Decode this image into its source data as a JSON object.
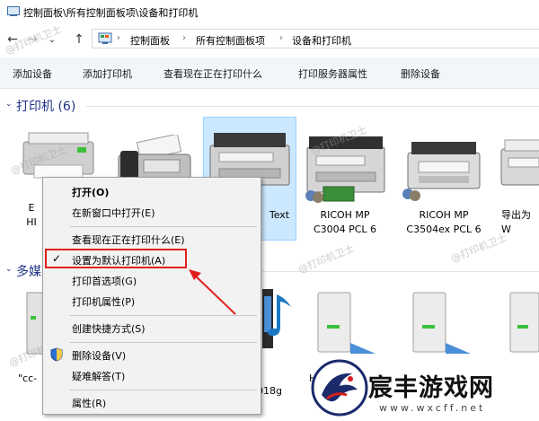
{
  "window": {
    "title": "控制面板\\所有控制面板项\\设备和打印机"
  },
  "nav": {
    "back": "←",
    "forward": "→",
    "dropdown": "⌄",
    "up": "↑"
  },
  "breadcrumb": [
    {
      "label": "控制面板"
    },
    {
      "label": "所有控制面板项"
    },
    {
      "label": "设备和打印机"
    }
  ],
  "toolbar": {
    "add_device": "添加设备",
    "add_printer": "添加打印机",
    "see_printing": "查看现在正在打印什么",
    "print_server_props": "打印服务器属性",
    "remove_device": "删除设备"
  },
  "printers_group": {
    "title": "打印机 (6)"
  },
  "printers": {
    "p1": {
      "line1": "E",
      "line2": "HI"
    },
    "p3": {
      "line1": "Text"
    },
    "p4": {
      "line1": "RICOH MP",
      "line2": "C3004 PCL 6"
    },
    "p5": {
      "line1": "RICOH MP",
      "line2": "C3504ex PCL 6"
    },
    "p6": {
      "line1": "导出为W"
    }
  },
  "media_group": {
    "title": "多媒"
  },
  "media_devices": {
    "m1": {
      "label": "\"cc-"
    },
    "m2": {
      "label": "018g"
    },
    "m3": {
      "label": "H"
    }
  },
  "context_menu": {
    "open": "打开(O)",
    "open_new_window": "在新窗口中打开(E)",
    "see_printing": "查看现在正在打印什么(E)",
    "set_default": "设置为默认打印机(A)",
    "printing_prefs": "打印首选项(G)",
    "printer_props": "打印机属性(P)",
    "create_shortcut": "创建快捷方式(S)",
    "remove_device": "删除设备(V)",
    "troubleshoot": "疑难解答(T)",
    "properties": "属性(R)"
  },
  "watermark": {
    "text": "@打印机卫士"
  },
  "brand": {
    "name": "宸丰游戏网",
    "url": "www.wxcff.net"
  },
  "colors": {
    "accent": "#1e3287",
    "highlight_border": "#e0201c",
    "selection_bg": "#cce8ff",
    "toolbar_bg": "#f3f6f9"
  }
}
